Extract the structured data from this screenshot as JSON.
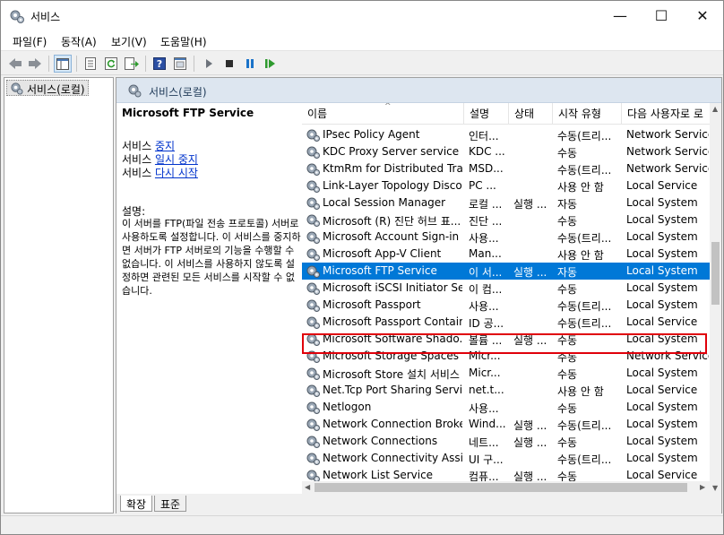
{
  "window": {
    "title": "서비스",
    "minimize": "—",
    "maximize": "☐",
    "close": "✕"
  },
  "menu": [
    "파일(F)",
    "동작(A)",
    "보기(V)",
    "도움말(H)"
  ],
  "toolbar_icons": [
    "back-icon",
    "forward-icon",
    "show-tree-icon",
    "properties-icon",
    "refresh-icon",
    "export-icon",
    "help-icon",
    "view-icon",
    "start-icon",
    "stop-icon",
    "pause-icon",
    "restart-icon"
  ],
  "tree": {
    "label": "서비스(로컬)"
  },
  "right_header": {
    "title": "서비스(로컬)"
  },
  "description": {
    "service_name": "Microsoft FTP Service",
    "link_rows": [
      {
        "prefix": "서비스 ",
        "link": "중지"
      },
      {
        "prefix": "서비스 ",
        "link": "일시 중지"
      },
      {
        "prefix": "서비스 ",
        "link": "다시 시작"
      }
    ],
    "desc_title": "설명:",
    "desc_text": "이 서버를 FTP(파일 전송 프로토콜) 서버로 사용하도록 설정합니다. 이 서비스를 중지하면 서버가 FTP 서버로의 기능을 수행할 수 없습니다. 이 서비스를 사용하지 않도록 설정하면 관련된 모든 서비스를 시작할 수 없습니다."
  },
  "columns": [
    "이름",
    "설명",
    "상태",
    "시작 유형",
    "다음 사용자로 로"
  ],
  "sort_indicator": "^",
  "services": [
    {
      "name": "IPsec Policy Agent",
      "desc": "인터...",
      "status": "",
      "startup": "수동(트리...",
      "logon": "Network Service"
    },
    {
      "name": "KDC Proxy Server service (...",
      "desc": "KDC ...",
      "status": "",
      "startup": "수동",
      "logon": "Network Service"
    },
    {
      "name": "KtmRm for Distributed Tra...",
      "desc": "MSD...",
      "status": "",
      "startup": "수동(트리...",
      "logon": "Network Service"
    },
    {
      "name": "Link-Layer Topology Disco...",
      "desc": "PC ...",
      "status": "",
      "startup": "사용 안 함",
      "logon": "Local Service"
    },
    {
      "name": "Local Session Manager",
      "desc": "로컬 ...",
      "status": "실행 ...",
      "startup": "자동",
      "logon": "Local System"
    },
    {
      "name": "Microsoft (R) 진단 허브 표...",
      "desc": "진단 ...",
      "status": "",
      "startup": "수동",
      "logon": "Local System"
    },
    {
      "name": "Microsoft Account Sign-in ...",
      "desc": "사용...",
      "status": "",
      "startup": "수동(트리...",
      "logon": "Local System"
    },
    {
      "name": "Microsoft App-V Client",
      "desc": "Man...",
      "status": "",
      "startup": "사용 안 함",
      "logon": "Local System"
    },
    {
      "name": "Microsoft FTP Service",
      "desc": "이 서...",
      "status": "실행 ...",
      "startup": "자동",
      "logon": "Local System"
    },
    {
      "name": "Microsoft iSCSI Initiator Se...",
      "desc": "이 컴...",
      "status": "",
      "startup": "수동",
      "logon": "Local System"
    },
    {
      "name": "Microsoft Passport",
      "desc": "사용...",
      "status": "",
      "startup": "수동(트리...",
      "logon": "Local System"
    },
    {
      "name": "Microsoft Passport Container",
      "desc": "ID 공...",
      "status": "",
      "startup": "수동(트리...",
      "logon": "Local Service"
    },
    {
      "name": "Microsoft Software Shado...",
      "desc": "볼륨 ...",
      "status": "실행 ...",
      "startup": "수동",
      "logon": "Local System"
    },
    {
      "name": "Microsoft Storage Spaces ...",
      "desc": "Micr...",
      "status": "",
      "startup": "수동",
      "logon": "Network Service"
    },
    {
      "name": "Microsoft Store 설치 서비스",
      "desc": "Micr...",
      "status": "",
      "startup": "수동",
      "logon": "Local System"
    },
    {
      "name": "Net.Tcp Port Sharing Service",
      "desc": "net.t...",
      "status": "",
      "startup": "사용 안 함",
      "logon": "Local Service"
    },
    {
      "name": "Netlogon",
      "desc": "사용...",
      "status": "",
      "startup": "수동",
      "logon": "Local System"
    },
    {
      "name": "Network Connection Broker",
      "desc": "Wind...",
      "status": "실행 ...",
      "startup": "수동(트리...",
      "logon": "Local System"
    },
    {
      "name": "Network Connections",
      "desc": "네트...",
      "status": "실행 ...",
      "startup": "수동",
      "logon": "Local System"
    },
    {
      "name": "Network Connectivity Assis...",
      "desc": "UI 구...",
      "status": "",
      "startup": "수동(트리...",
      "logon": "Local System"
    },
    {
      "name": "Network List Service",
      "desc": "컴퓨...",
      "status": "실행 ...",
      "startup": "수동",
      "logon": "Local Service"
    }
  ],
  "selected_service": "Microsoft FTP Service",
  "tabs": [
    "확장",
    "표준"
  ],
  "colors": {
    "selection": "#0078d7",
    "highlight_border": "#e0000a",
    "link": "#0033cc"
  }
}
